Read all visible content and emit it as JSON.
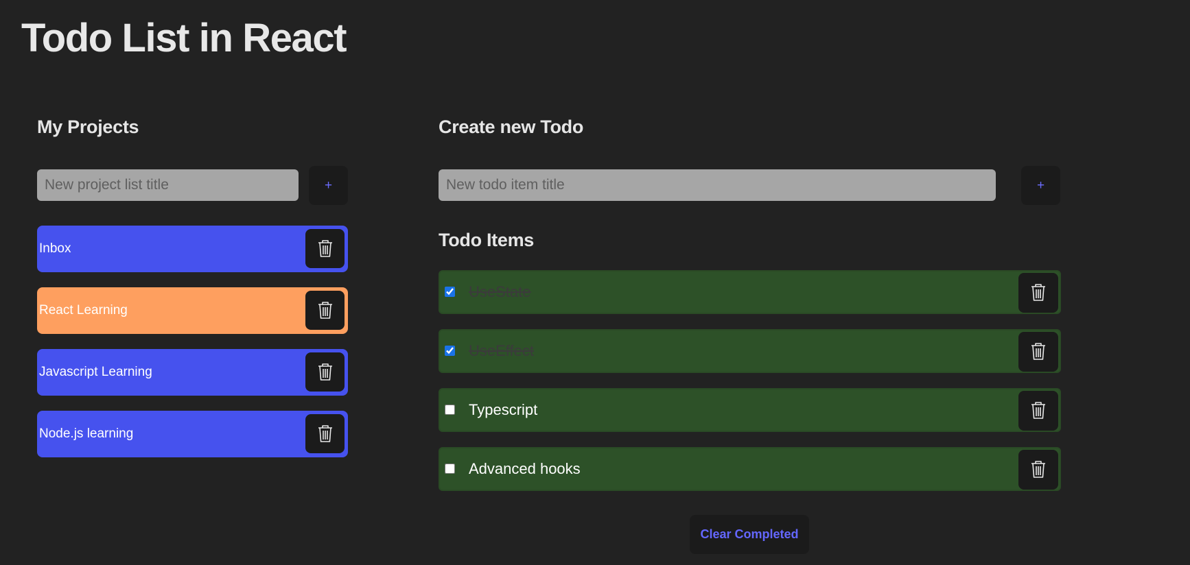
{
  "app": {
    "title": "Todo List in React"
  },
  "projects": {
    "heading": "My Projects",
    "input_placeholder": "New project list title",
    "add_label": "+",
    "items": [
      {
        "label": "Inbox",
        "color": "#4652ee",
        "delete_icon": "trash-icon"
      },
      {
        "label": "React Learning",
        "color": "#fe9f5f",
        "delete_icon": "trash-icon"
      },
      {
        "label": "Javascript Learning",
        "color": "#4652ee",
        "delete_icon": "trash-icon"
      },
      {
        "label": "Node.js learning",
        "color": "#4652ee",
        "delete_icon": "trash-icon"
      }
    ]
  },
  "create": {
    "heading": "Create new Todo",
    "input_placeholder": "New todo item title",
    "add_label": "+"
  },
  "todos": {
    "heading": "Todo Items",
    "items": [
      {
        "label": "UseState",
        "completed": true
      },
      {
        "label": "UseEffect",
        "completed": true
      },
      {
        "label": "Typescript",
        "completed": false
      },
      {
        "label": "Advanced hooks",
        "completed": false
      }
    ],
    "clear_label": "Clear Completed"
  },
  "colors": {
    "background": "#222222",
    "accent": "#6467ff",
    "project_default": "#4652ee",
    "project_active": "#fe9f5f",
    "todo_background": "#2d5128"
  }
}
